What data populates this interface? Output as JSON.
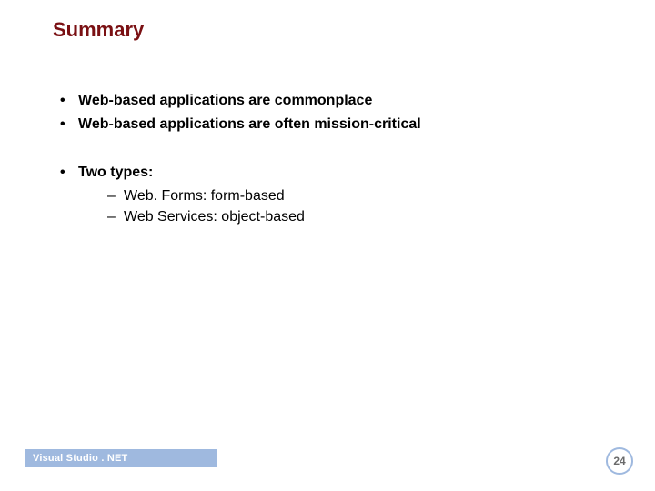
{
  "title": "Summary",
  "bullets": {
    "group1": [
      "Web-based applications are commonplace",
      "Web-based applications are often mission-critical"
    ],
    "group2": {
      "lead": "Two types:",
      "sub": [
        "Web. Forms:  form-based",
        "Web Services:  object-based"
      ]
    }
  },
  "footer": {
    "label": "Visual Studio . NET"
  },
  "page_number": "24",
  "colors": {
    "title": "#7a1013",
    "footer_bg": "#9fb9df",
    "footer_text": "#ffffff",
    "badge_border": "#9fb9df",
    "badge_text": "#6a6a6a"
  }
}
